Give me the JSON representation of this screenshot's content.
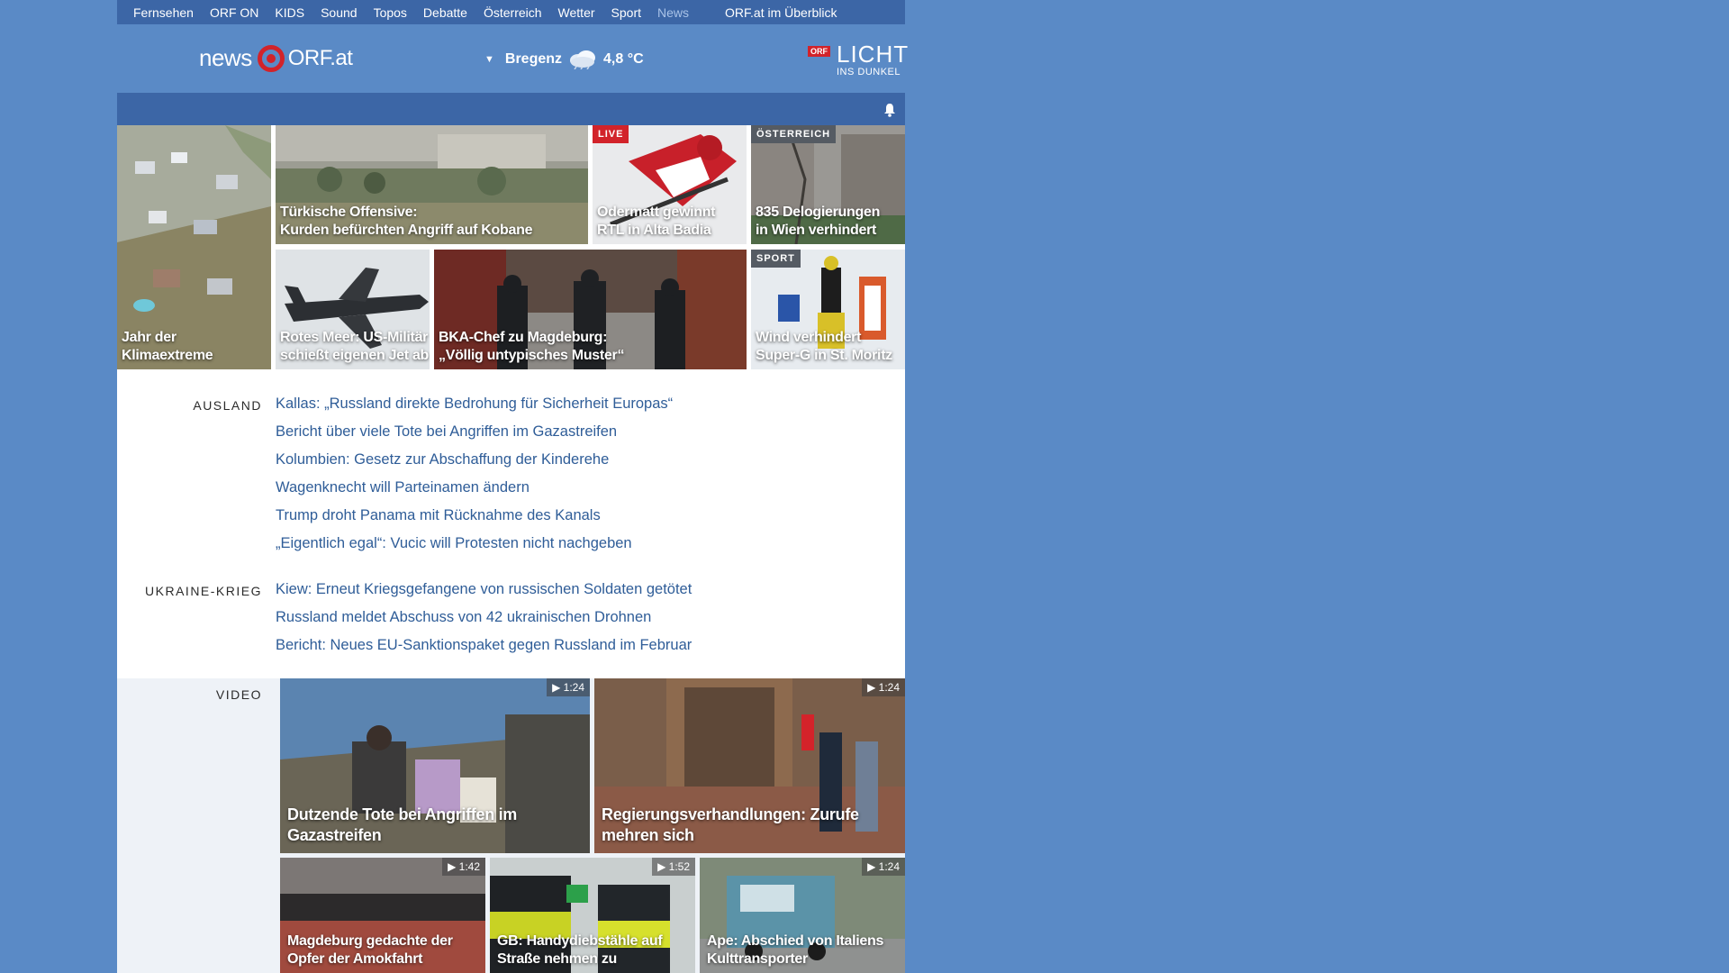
{
  "topnav": {
    "items": [
      "Fernsehen",
      "ORF ON",
      "KIDS",
      "Sound",
      "Topos",
      "Debatte",
      "Österreich",
      "Wetter",
      "Sport",
      "News"
    ],
    "overview": "ORF.at im Überblick"
  },
  "header": {
    "logo_news": "news",
    "logo_orf": "ORF.at",
    "location": "Bregenz",
    "temperature": "4,8 °C",
    "licht_badge": "ORF",
    "licht_big": "LICHT",
    "licht_small": "INS DUNKEL"
  },
  "colors": {
    "page_bg": "#5a8ac6",
    "nav_bg": "#3c66a6",
    "link": "#2f5d98",
    "live": "#d2232a"
  },
  "tiles": [
    {
      "caption": "Jahr der Klimaextreme"
    },
    {
      "caption_line1": "Türkische Offensive:",
      "caption_line2": "Kurden befürchten Angriff auf Kobane"
    },
    {
      "tag": "LIVE",
      "caption_line1": "Odermatt gewinnt",
      "caption_line2": "RTL in Alta Badia"
    },
    {
      "tag": "ÖSTERREICH",
      "caption_line1": "835 Delogierungen",
      "caption_line2": "in Wien verhindert"
    },
    {
      "caption_line1": "Rotes Meer: US-Militär",
      "caption_line2": "schießt eigenen Jet ab"
    },
    {
      "caption_line1": "BKA-Chef zu Magdeburg:",
      "caption_line2": "„Völlig untypisches Muster“"
    },
    {
      "tag": "SPORT",
      "caption_line1": "Wind verhindert",
      "caption_line2": "Super-G in St. Moritz"
    }
  ],
  "sections": [
    {
      "label": "AUSLAND",
      "links": [
        "Kallas: „Russland direkte Bedrohung für Sicherheit Europas“",
        "Bericht über viele Tote bei Angriffen im Gazastreifen",
        "Kolumbien: Gesetz zur Abschaffung der Kinderehe",
        "Wagenknecht will Parteinamen ändern",
        "Trump droht Panama mit Rücknahme des Kanals",
        "„Eigentlich egal“: Vucic will Protesten nicht nachgeben"
      ]
    },
    {
      "label": "UKRAINE-KRIEG",
      "links": [
        "Kiew: Erneut Kriegsgefangene von russischen Soldaten getötet",
        "Russland meldet Abschuss von 42 ukrainischen Drohnen",
        "Bericht: Neues EU-Sanktionspaket gegen Russland im Februar"
      ]
    }
  ],
  "video": {
    "label": "VIDEO",
    "items": [
      {
        "duration": "1:24",
        "caption_line1": "Dutzende Tote bei Angriffen im",
        "caption_line2": "Gazastreifen"
      },
      {
        "duration": "1:24",
        "caption_line1": "Regierungsverhandlungen: Zurufe",
        "caption_line2": "mehren sich"
      },
      {
        "duration": "1:42",
        "caption_line1": "Magdeburg gedachte der",
        "caption_line2": "Opfer der Amokfahrt"
      },
      {
        "duration": "1:52",
        "caption_line1": "GB: Handydiebstähle auf",
        "caption_line2": "Straße nehmen zu"
      },
      {
        "duration": "1:24",
        "caption_line1": "Ape: Abschied von Italiens",
        "caption_line2": "Kulttransporter"
      }
    ]
  }
}
